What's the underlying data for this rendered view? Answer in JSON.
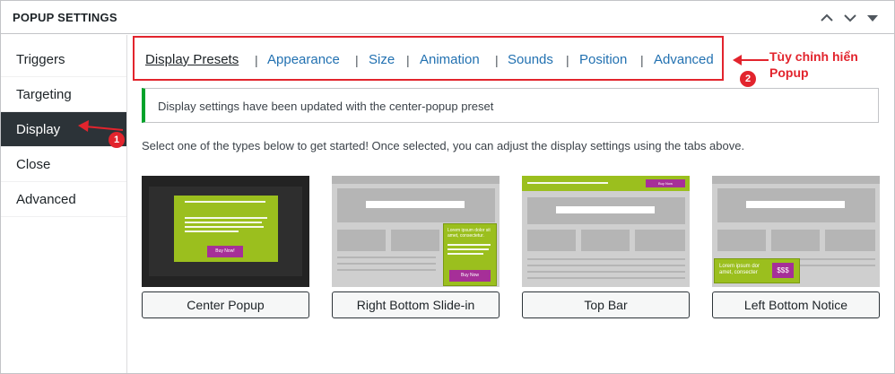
{
  "header": {
    "title": "POPUP SETTINGS"
  },
  "sidebar": {
    "items": [
      {
        "label": "Triggers"
      },
      {
        "label": "Targeting"
      },
      {
        "label": "Display"
      },
      {
        "label": "Close"
      },
      {
        "label": "Advanced"
      }
    ],
    "active": "Display"
  },
  "tabs": [
    {
      "label": "Display Presets"
    },
    {
      "label": "Appearance"
    },
    {
      "label": "Size"
    },
    {
      "label": "Animation"
    },
    {
      "label": "Sounds"
    },
    {
      "label": "Position"
    },
    {
      "label": "Advanced"
    }
  ],
  "tab_separator": "|",
  "annotation": {
    "text": "Tùy chỉnh hiển Popup",
    "badge1": "1",
    "badge2": "2"
  },
  "notice": {
    "text": "Display settings have been updated with the center-popup preset"
  },
  "intro": "Select one of the types below to get started! Once selected, you can adjust the display settings using the tabs above.",
  "presets": [
    {
      "label": "Center Popup",
      "cta": "Buy Now!"
    },
    {
      "label": "Right Bottom Slide-in",
      "body": "Lorem ipsum dolor sit amet, consectetur.",
      "cta": "Buy Now"
    },
    {
      "label": "Top Bar",
      "cta": "Buy Now"
    },
    {
      "label": "Left Bottom Notice",
      "body": "Lorem ipsum dor amet, consecter",
      "cta": "$$$"
    }
  ],
  "colors": {
    "accent": "#9bbf1e",
    "cta": "#a62f98",
    "annotation": "#e2242d",
    "notice_border": "#00a32a",
    "active_bg": "#2c3338",
    "link": "#2271b1"
  }
}
